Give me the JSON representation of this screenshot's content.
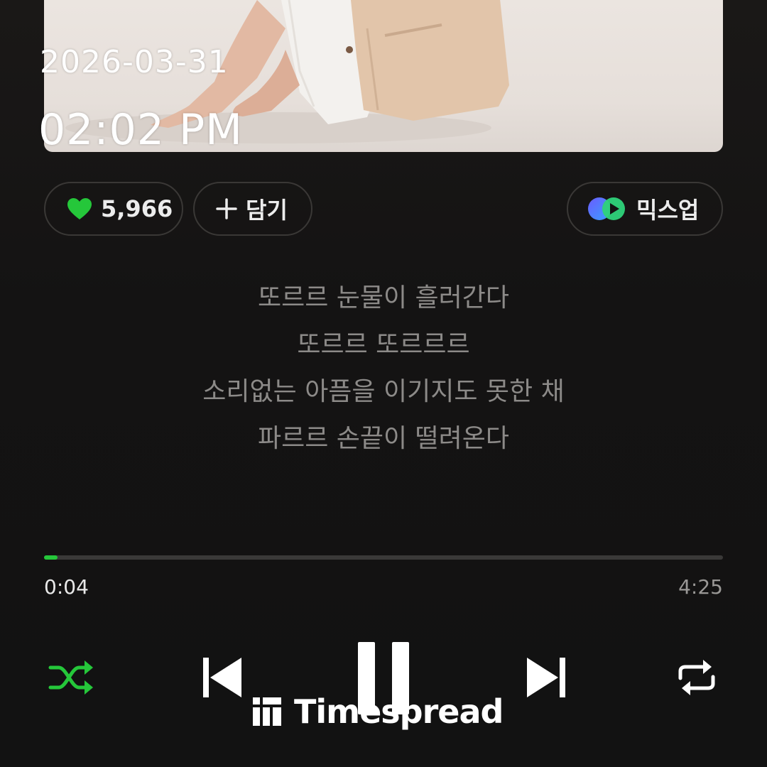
{
  "overlay": {
    "date": "2026-03-31",
    "time": "02:02 PM"
  },
  "actions": {
    "like_count": "5,966",
    "add_label": "담기",
    "mixup_label": "믹스업"
  },
  "lyrics": [
    "또르르 눈물이 흘러간다",
    "또르르 또르르르",
    "소리없는 아픔을 이기지도 못한 채",
    "파르르 손끝이 떨려온다"
  ],
  "playback": {
    "current_time": "0:04",
    "total_time": "4:25",
    "progress_fraction": 0.02
  },
  "controls": {
    "shuffle_icon": "shuffle-icon",
    "prev_icon": "skip-previous-icon",
    "pause_icon": "pause-icon",
    "next_icon": "skip-next-icon",
    "repeat_icon": "repeat-icon"
  },
  "watermark": {
    "text": "Timespread"
  },
  "colors": {
    "accent": "#25c73a",
    "background": "#131212",
    "lyric": "#8c8a88"
  }
}
